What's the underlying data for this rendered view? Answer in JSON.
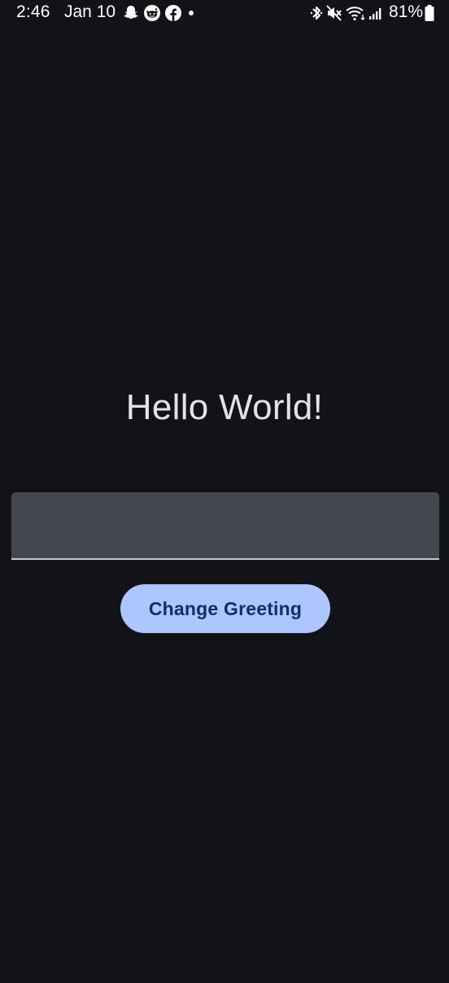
{
  "status_bar": {
    "time": "2:46",
    "date": "Jan 10",
    "battery_percent": "81%",
    "left_icons": [
      "snapchat-icon",
      "reddit-icon",
      "facebook-icon",
      "notification-dot-icon"
    ],
    "right_icons": [
      "bluetooth-icon",
      "vibrate-mute-icon",
      "wifi-icon",
      "signal-icon",
      "battery-icon"
    ]
  },
  "main": {
    "greeting": "Hello World!",
    "input": {
      "value": "",
      "placeholder": ""
    },
    "button_label": "Change Greeting"
  },
  "colors": {
    "background": "#111318",
    "text": "#e2e2e9",
    "input_fill": "#44474f",
    "input_underline": "#c4c6d0",
    "button_fill": "#adc6ff",
    "button_text": "#102f60"
  }
}
